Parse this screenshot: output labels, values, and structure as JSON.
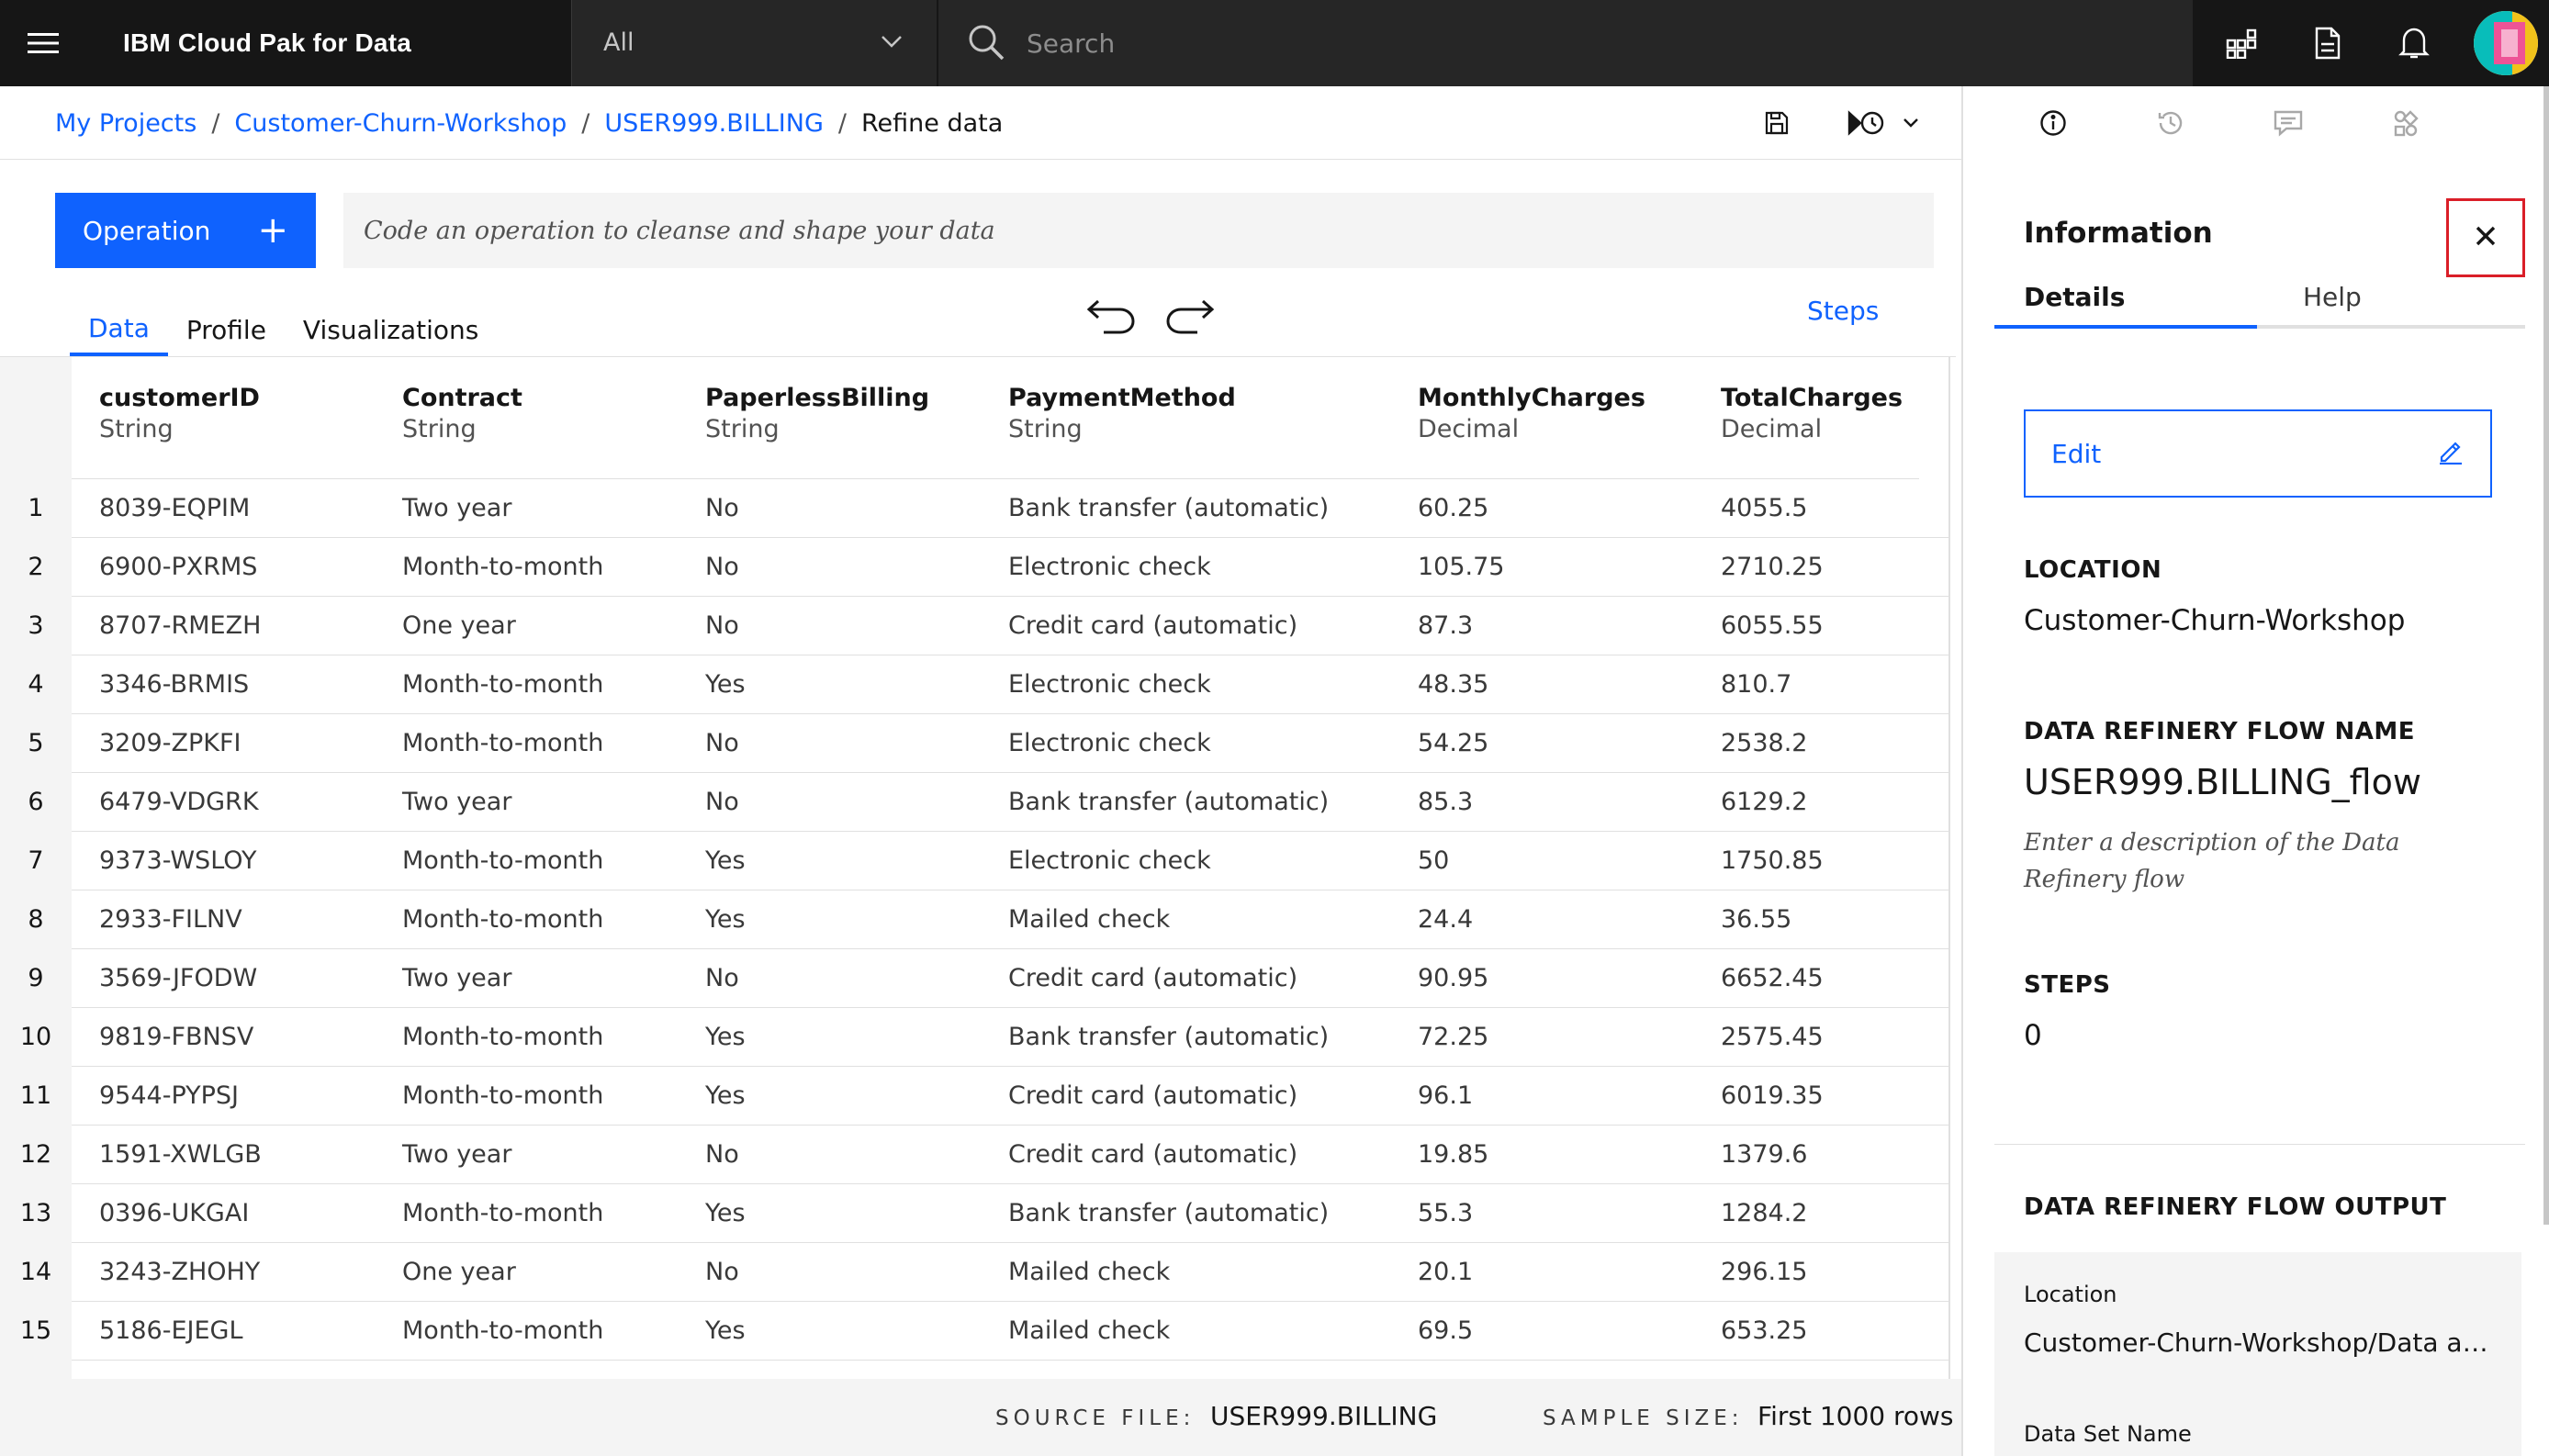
{
  "topbar": {
    "app_name": "IBM Cloud Pak for Data",
    "scope_value": "All",
    "search_placeholder": "Search"
  },
  "breadcrumb": {
    "items": [
      "My Projects",
      "Customer-Churn-Workshop",
      "USER999.BILLING"
    ],
    "current": "Refine data",
    "separator": "/"
  },
  "operation": {
    "button_label": "Operation",
    "button_plus": "+",
    "placeholder": "Code an operation to cleanse and shape your data"
  },
  "tabs": [
    "Data",
    "Profile",
    "Visualizations"
  ],
  "steps_link": "Steps",
  "table": {
    "columns": [
      {
        "name": "customerID",
        "type": "String"
      },
      {
        "name": "Contract",
        "type": "String"
      },
      {
        "name": "PaperlessBilling",
        "type": "String"
      },
      {
        "name": "PaymentMethod",
        "type": "String"
      },
      {
        "name": "MonthlyCharges",
        "type": "Decimal"
      },
      {
        "name": "TotalCharges",
        "type": "Decimal"
      }
    ],
    "rows": [
      {
        "num": "1",
        "cells": [
          "8039-EQPIM",
          "Two year",
          "No",
          "Bank transfer (automatic)",
          "60.25",
          "4055.5"
        ]
      },
      {
        "num": "2",
        "cells": [
          "6900-PXRMS",
          "Month-to-month",
          "No",
          "Electronic check",
          "105.75",
          "2710.25"
        ]
      },
      {
        "num": "3",
        "cells": [
          "8707-RMEZH",
          "One year",
          "No",
          "Credit card (automatic)",
          "87.3",
          "6055.55"
        ]
      },
      {
        "num": "4",
        "cells": [
          "3346-BRMIS",
          "Month-to-month",
          "Yes",
          "Electronic check",
          "48.35",
          "810.7"
        ]
      },
      {
        "num": "5",
        "cells": [
          "3209-ZPKFI",
          "Month-to-month",
          "No",
          "Electronic check",
          "54.25",
          "2538.2"
        ]
      },
      {
        "num": "6",
        "cells": [
          "6479-VDGRK",
          "Two year",
          "No",
          "Bank transfer (automatic)",
          "85.3",
          "6129.2"
        ]
      },
      {
        "num": "7",
        "cells": [
          "9373-WSLOY",
          "Month-to-month",
          "Yes",
          "Electronic check",
          "50",
          "1750.85"
        ]
      },
      {
        "num": "8",
        "cells": [
          "2933-FILNV",
          "Month-to-month",
          "Yes",
          "Mailed check",
          "24.4",
          "36.55"
        ]
      },
      {
        "num": "9",
        "cells": [
          "3569-JFODW",
          "Two year",
          "No",
          "Credit card (automatic)",
          "90.95",
          "6652.45"
        ]
      },
      {
        "num": "10",
        "cells": [
          "9819-FBNSV",
          "Month-to-month",
          "Yes",
          "Bank transfer (automatic)",
          "72.25",
          "2575.45"
        ]
      },
      {
        "num": "11",
        "cells": [
          "9544-PYPSJ",
          "Month-to-month",
          "Yes",
          "Credit card (automatic)",
          "96.1",
          "6019.35"
        ]
      },
      {
        "num": "12",
        "cells": [
          "1591-XWLGB",
          "Two year",
          "No",
          "Credit card (automatic)",
          "19.85",
          "1379.6"
        ]
      },
      {
        "num": "13",
        "cells": [
          "0396-UKGAI",
          "Month-to-month",
          "Yes",
          "Bank transfer (automatic)",
          "55.3",
          "1284.2"
        ]
      },
      {
        "num": "14",
        "cells": [
          "3243-ZHOHY",
          "One year",
          "No",
          "Mailed check",
          "20.1",
          "296.15"
        ]
      },
      {
        "num": "15",
        "cells": [
          "5186-EJEGL",
          "Month-to-month",
          "Yes",
          "Mailed check",
          "69.5",
          "653.25"
        ]
      }
    ]
  },
  "footer": {
    "source_label": "SOURCE FILE:",
    "source_value": "USER999.BILLING",
    "sample_label": "SAMPLE SIZE:",
    "sample_value": "First 1000 rows"
  },
  "panel": {
    "title": "Information",
    "tabs": [
      "Details",
      "Help"
    ],
    "edit_label": "Edit",
    "location_label": "LOCATION",
    "location_value": "Customer-Churn-Workshop",
    "flow_name_label": "DATA REFINERY FLOW NAME",
    "flow_name_value": "USER999.BILLING_flow",
    "description_placeholder": "Enter a description of the Data Refinery flow",
    "steps_label": "STEPS",
    "steps_value": "0",
    "output_label": "DATA REFINERY FLOW OUTPUT",
    "output_location_label": "Location",
    "output_location_value": "Customer-Churn-Workshop/Data ass...",
    "output_dataset_label": "Data Set Name"
  },
  "colors": {
    "accent": "#0f62fe",
    "topbar": "#161616",
    "highlight": "#da1e28"
  },
  "icons": [
    "menu-icon",
    "chevron-down-icon",
    "search-icon",
    "apps-icon",
    "document-icon",
    "notification-icon",
    "save-icon",
    "run-schedule-icon",
    "info-icon",
    "history-icon",
    "comment-icon",
    "settings-adjust-icon",
    "close-icon",
    "edit-icon",
    "undo-icon",
    "redo-icon"
  ]
}
